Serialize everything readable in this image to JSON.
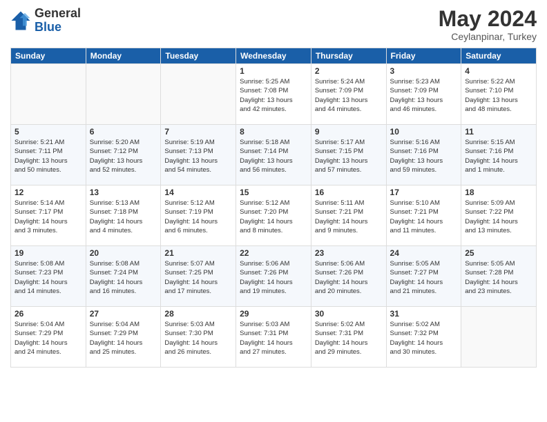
{
  "logo": {
    "general": "General",
    "blue": "Blue"
  },
  "title": {
    "month_year": "May 2024",
    "location": "Ceylanpinar, Turkey"
  },
  "weekdays": [
    "Sunday",
    "Monday",
    "Tuesday",
    "Wednesday",
    "Thursday",
    "Friday",
    "Saturday"
  ],
  "weeks": [
    [
      {
        "day": "",
        "info": ""
      },
      {
        "day": "",
        "info": ""
      },
      {
        "day": "",
        "info": ""
      },
      {
        "day": "1",
        "info": "Sunrise: 5:25 AM\nSunset: 7:08 PM\nDaylight: 13 hours\nand 42 minutes."
      },
      {
        "day": "2",
        "info": "Sunrise: 5:24 AM\nSunset: 7:09 PM\nDaylight: 13 hours\nand 44 minutes."
      },
      {
        "day": "3",
        "info": "Sunrise: 5:23 AM\nSunset: 7:09 PM\nDaylight: 13 hours\nand 46 minutes."
      },
      {
        "day": "4",
        "info": "Sunrise: 5:22 AM\nSunset: 7:10 PM\nDaylight: 13 hours\nand 48 minutes."
      }
    ],
    [
      {
        "day": "5",
        "info": "Sunrise: 5:21 AM\nSunset: 7:11 PM\nDaylight: 13 hours\nand 50 minutes."
      },
      {
        "day": "6",
        "info": "Sunrise: 5:20 AM\nSunset: 7:12 PM\nDaylight: 13 hours\nand 52 minutes."
      },
      {
        "day": "7",
        "info": "Sunrise: 5:19 AM\nSunset: 7:13 PM\nDaylight: 13 hours\nand 54 minutes."
      },
      {
        "day": "8",
        "info": "Sunrise: 5:18 AM\nSunset: 7:14 PM\nDaylight: 13 hours\nand 56 minutes."
      },
      {
        "day": "9",
        "info": "Sunrise: 5:17 AM\nSunset: 7:15 PM\nDaylight: 13 hours\nand 57 minutes."
      },
      {
        "day": "10",
        "info": "Sunrise: 5:16 AM\nSunset: 7:16 PM\nDaylight: 13 hours\nand 59 minutes."
      },
      {
        "day": "11",
        "info": "Sunrise: 5:15 AM\nSunset: 7:16 PM\nDaylight: 14 hours\nand 1 minute."
      }
    ],
    [
      {
        "day": "12",
        "info": "Sunrise: 5:14 AM\nSunset: 7:17 PM\nDaylight: 14 hours\nand 3 minutes."
      },
      {
        "day": "13",
        "info": "Sunrise: 5:13 AM\nSunset: 7:18 PM\nDaylight: 14 hours\nand 4 minutes."
      },
      {
        "day": "14",
        "info": "Sunrise: 5:12 AM\nSunset: 7:19 PM\nDaylight: 14 hours\nand 6 minutes."
      },
      {
        "day": "15",
        "info": "Sunrise: 5:12 AM\nSunset: 7:20 PM\nDaylight: 14 hours\nand 8 minutes."
      },
      {
        "day": "16",
        "info": "Sunrise: 5:11 AM\nSunset: 7:21 PM\nDaylight: 14 hours\nand 9 minutes."
      },
      {
        "day": "17",
        "info": "Sunrise: 5:10 AM\nSunset: 7:21 PM\nDaylight: 14 hours\nand 11 minutes."
      },
      {
        "day": "18",
        "info": "Sunrise: 5:09 AM\nSunset: 7:22 PM\nDaylight: 14 hours\nand 13 minutes."
      }
    ],
    [
      {
        "day": "19",
        "info": "Sunrise: 5:08 AM\nSunset: 7:23 PM\nDaylight: 14 hours\nand 14 minutes."
      },
      {
        "day": "20",
        "info": "Sunrise: 5:08 AM\nSunset: 7:24 PM\nDaylight: 14 hours\nand 16 minutes."
      },
      {
        "day": "21",
        "info": "Sunrise: 5:07 AM\nSunset: 7:25 PM\nDaylight: 14 hours\nand 17 minutes."
      },
      {
        "day": "22",
        "info": "Sunrise: 5:06 AM\nSunset: 7:26 PM\nDaylight: 14 hours\nand 19 minutes."
      },
      {
        "day": "23",
        "info": "Sunrise: 5:06 AM\nSunset: 7:26 PM\nDaylight: 14 hours\nand 20 minutes."
      },
      {
        "day": "24",
        "info": "Sunrise: 5:05 AM\nSunset: 7:27 PM\nDaylight: 14 hours\nand 21 minutes."
      },
      {
        "day": "25",
        "info": "Sunrise: 5:05 AM\nSunset: 7:28 PM\nDaylight: 14 hours\nand 23 minutes."
      }
    ],
    [
      {
        "day": "26",
        "info": "Sunrise: 5:04 AM\nSunset: 7:29 PM\nDaylight: 14 hours\nand 24 minutes."
      },
      {
        "day": "27",
        "info": "Sunrise: 5:04 AM\nSunset: 7:29 PM\nDaylight: 14 hours\nand 25 minutes."
      },
      {
        "day": "28",
        "info": "Sunrise: 5:03 AM\nSunset: 7:30 PM\nDaylight: 14 hours\nand 26 minutes."
      },
      {
        "day": "29",
        "info": "Sunrise: 5:03 AM\nSunset: 7:31 PM\nDaylight: 14 hours\nand 27 minutes."
      },
      {
        "day": "30",
        "info": "Sunrise: 5:02 AM\nSunset: 7:31 PM\nDaylight: 14 hours\nand 29 minutes."
      },
      {
        "day": "31",
        "info": "Sunrise: 5:02 AM\nSunset: 7:32 PM\nDaylight: 14 hours\nand 30 minutes."
      },
      {
        "day": "",
        "info": ""
      }
    ]
  ],
  "colors": {
    "header_bg": "#1a5fa8",
    "header_text": "#ffffff",
    "border": "#dddddd"
  }
}
